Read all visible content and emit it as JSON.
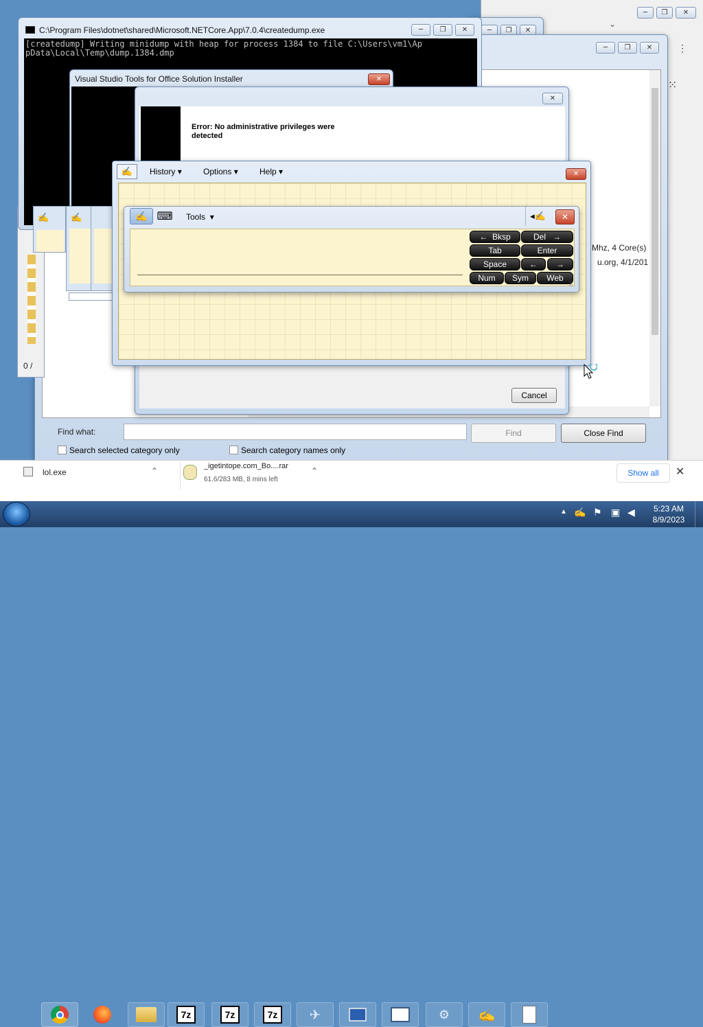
{
  "console": {
    "title": "C:\\Program Files\\dotnet\\shared\\Microsoft.NETCore.App\\7.0.4\\createdump.exe",
    "line1": "[createdump] Writing minidump with heap for process 1384 to file C:\\Users\\vm1\\Ap",
    "line2": "pData\\Local\\Temp\\dump.1384.dmp"
  },
  "vsto": {
    "title": "Visual Studio Tools for Office Solution Installer"
  },
  "error_dialog": {
    "message": "Error: No administrative privileges were detected",
    "cancel_label": "Cancel"
  },
  "background": {
    "sysinfo1": "Mhz, 4 Core(s)",
    "sysinfo2": "u.org, 4/1/201",
    "status_partial": "0 /"
  },
  "tip_menu": {
    "history": "History",
    "options": "Options",
    "help": "Help"
  },
  "tip_panel": {
    "tools": "Tools",
    "keys": {
      "bksp": "Bksp",
      "del": "Del",
      "tab": "Tab",
      "enter": "Enter",
      "space": "Space",
      "num": "Num",
      "sym": "Sym",
      "web": "Web"
    }
  },
  "find": {
    "label": "Find what:",
    "value": "",
    "find_button": "Find",
    "close_button": "Close Find",
    "opt1": "Search selected category only",
    "opt2": "Search category names only"
  },
  "downloads": {
    "item1": "lol.exe",
    "item2_name": "_igetintope.com_Bo....rar",
    "item2_progress": "61.6/283 MB, 8 mins left",
    "show_all": "Show all"
  },
  "taskbar": {
    "time": "5:23 AM",
    "date": "8/9/2023"
  },
  "colors": {
    "console_bg": "#000000",
    "tip_bg": "#fbf4cf",
    "taskbar": "#2b5384"
  }
}
